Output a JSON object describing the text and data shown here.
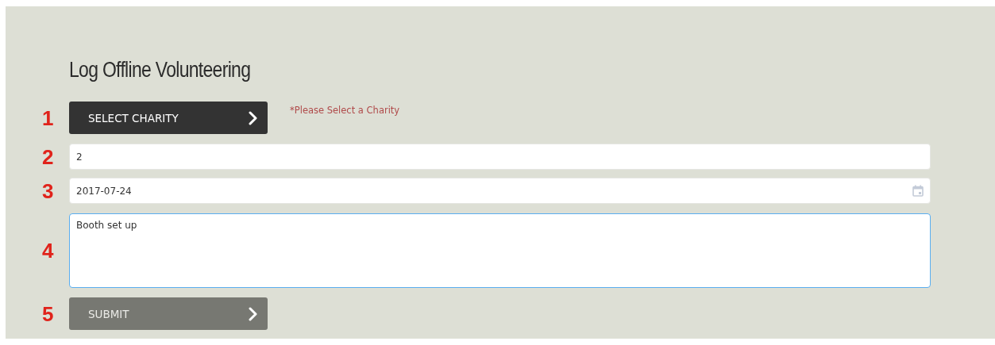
{
  "title": "Log Offline Volunteering",
  "steps": [
    {
      "number": "1",
      "kind": "button",
      "label": "SELECT CHARITY",
      "disabled": false,
      "hint": "*Please Select a Charity"
    },
    {
      "number": "2",
      "kind": "field",
      "value": "2",
      "focused": false
    },
    {
      "number": "3",
      "kind": "date",
      "value": "2017-07-24",
      "focused": false
    },
    {
      "number": "4",
      "kind": "textarea",
      "value": "Booth set up",
      "focused": true
    },
    {
      "number": "5",
      "kind": "button",
      "label": "SUBMIT",
      "disabled": true
    }
  ]
}
